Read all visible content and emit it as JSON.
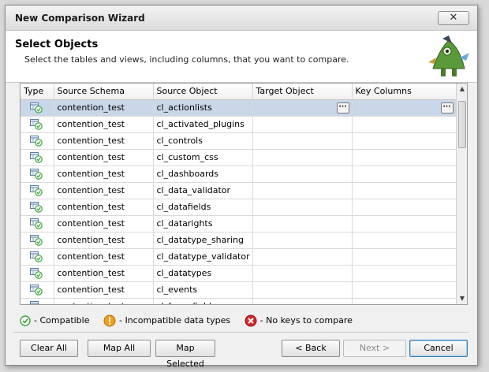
{
  "window": {
    "title": "New Comparison Wizard",
    "close_label": "✕"
  },
  "header": {
    "title": "Select Objects",
    "subtitle": "Select the tables and views, including columns, that you want to compare."
  },
  "grid": {
    "columns": [
      "Type",
      "Source Schema",
      "Source Object",
      "Target Object",
      "Key Columns"
    ],
    "rows": [
      {
        "schema": "contention_test",
        "object": "cl_actionlists"
      },
      {
        "schema": "contention_test",
        "object": "cl_activated_plugins"
      },
      {
        "schema": "contention_test",
        "object": "cl_controls"
      },
      {
        "schema": "contention_test",
        "object": "cl_custom_css"
      },
      {
        "schema": "contention_test",
        "object": "cl_dashboards"
      },
      {
        "schema": "contention_test",
        "object": "cl_data_validator"
      },
      {
        "schema": "contention_test",
        "object": "cl_datafields"
      },
      {
        "schema": "contention_test",
        "object": "cl_datarights"
      },
      {
        "schema": "contention_test",
        "object": "cl_datatype_sharing"
      },
      {
        "schema": "contention_test",
        "object": "cl_datatype_validator"
      },
      {
        "schema": "contention_test",
        "object": "cl_datatypes"
      },
      {
        "schema": "contention_test",
        "object": "cl_events"
      },
      {
        "schema": "contention_test",
        "object": "cl_form_fields"
      }
    ],
    "ellipsis_label": "···"
  },
  "legend": {
    "compatible": "- Compatible",
    "incompatible": "- Incompatible data types",
    "no_keys": "- No keys to compare"
  },
  "buttons": {
    "clear_all": "Clear All",
    "map_all": "Map All",
    "map_selected": "Map Selected",
    "back": "< Back",
    "next": "Next >",
    "cancel": "Cancel"
  },
  "colors": {
    "selected_row": "#c9d7e8",
    "compatible_green": "#3aa63a",
    "warning_orange": "#f0a020",
    "error_red": "#d42a2a"
  }
}
